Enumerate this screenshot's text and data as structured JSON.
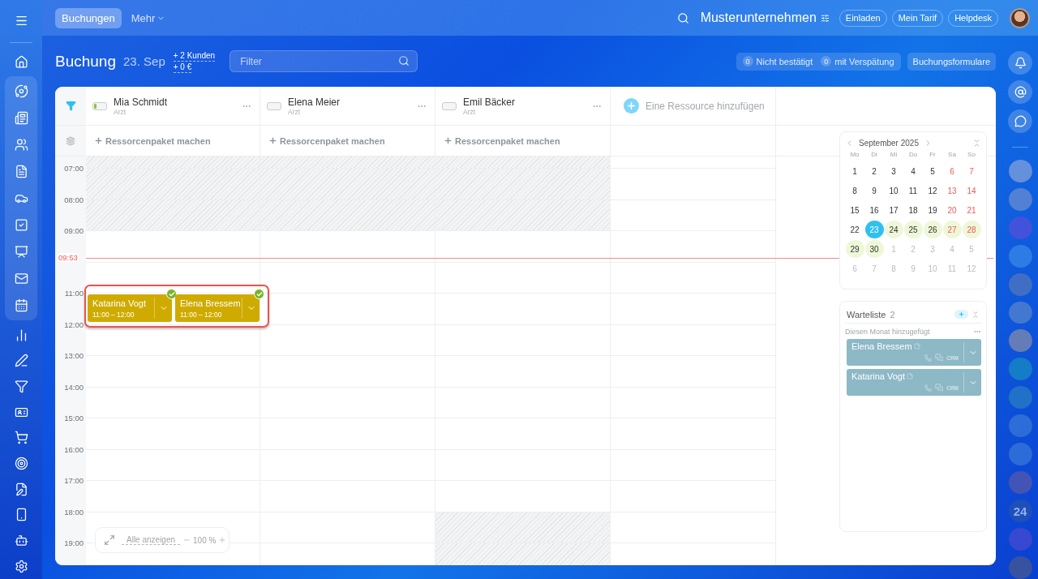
{
  "topbar": {
    "nav": [
      {
        "label": "Buchungen",
        "selected": true
      },
      {
        "label": "Mehr",
        "selected": false
      }
    ],
    "company": "Musterunternehmen",
    "buttons": [
      "Einladen",
      "Mein Tarif",
      "Helpdesk"
    ]
  },
  "header": {
    "title": "Buchung",
    "date": "23. Sep",
    "stats": [
      "+ 2 Kunden",
      "+ 0 €"
    ],
    "filter_placeholder": "Filter",
    "counters": [
      {
        "count": "0",
        "label": "Nicht bestätigt"
      },
      {
        "count": "0",
        "label": "mit Verspätung"
      }
    ],
    "forms_button": "Buchungsformulare"
  },
  "resources": [
    {
      "name": "Mia Schmidt",
      "role": "Arzt",
      "level": 0.2,
      "package": "Ressorcenpaket machen"
    },
    {
      "name": "Elena Meier",
      "role": "Arzt",
      "level": 0,
      "package": "Ressorcenpaket machen"
    },
    {
      "name": "Emil Bäcker",
      "role": "Arzt",
      "level": 0,
      "package": "Ressorcenpaket machen"
    }
  ],
  "add_resource": "Eine Ressource hinzufügen",
  "hours": [
    {
      "time": "07:00",
      "blocked": [
        true,
        true,
        true
      ]
    },
    {
      "time": "08:00",
      "blocked": [
        true,
        true,
        true
      ]
    },
    {
      "time": "09:00",
      "blocked": [
        false,
        false,
        false
      ]
    },
    {
      "blocked": [
        false,
        false,
        false
      ]
    },
    {
      "time": "11:00",
      "blocked": [
        false,
        false,
        false
      ]
    },
    {
      "time": "12:00",
      "blocked": [
        false,
        false,
        false
      ]
    },
    {
      "time": "13:00",
      "blocked": [
        false,
        false,
        false
      ]
    },
    {
      "time": "14:00",
      "blocked": [
        false,
        false,
        false
      ]
    },
    {
      "time": "15:00",
      "blocked": [
        false,
        false,
        false
      ]
    },
    {
      "time": "16:00",
      "blocked": [
        false,
        false,
        false
      ]
    },
    {
      "time": "17:00",
      "blocked": [
        false,
        false,
        false
      ]
    },
    {
      "time": "18:00",
      "blocked": [
        false,
        false,
        true
      ]
    },
    {
      "time": "19:00",
      "blocked": [
        false,
        false,
        true
      ]
    }
  ],
  "now": "09:53",
  "bookings": [
    {
      "name": "Katarina Vogt",
      "time": "11:00 – 12:00",
      "confirmed": true
    },
    {
      "name": "Elena Bressem",
      "time": "11:00 – 12:00",
      "confirmed": true
    }
  ],
  "zoom": {
    "show_all": "Alle anzeigen",
    "value": "100 %"
  },
  "mini_calendar": {
    "month": "September 2025",
    "weekdays": [
      "Mo",
      "Di",
      "Mi",
      "Do",
      "Fr",
      "Sa",
      "So"
    ],
    "weeks": [
      [
        {
          "day": "1",
          "kind": "weekday",
          "selected": false,
          "marked": false
        },
        {
          "day": "2",
          "kind": "weekday",
          "selected": false,
          "marked": false
        },
        {
          "day": "3",
          "kind": "weekday",
          "selected": false,
          "marked": false
        },
        {
          "day": "4",
          "kind": "weekday",
          "selected": false,
          "marked": false
        },
        {
          "day": "5",
          "kind": "weekday",
          "selected": false,
          "marked": false
        },
        {
          "day": "6",
          "kind": "weekend",
          "selected": false,
          "marked": false
        },
        {
          "day": "7",
          "kind": "weekend",
          "selected": false,
          "marked": false
        }
      ],
      [
        {
          "day": "8",
          "kind": "weekday",
          "selected": false,
          "marked": false
        },
        {
          "day": "9",
          "kind": "weekday",
          "selected": false,
          "marked": false
        },
        {
          "day": "10",
          "kind": "weekday",
          "selected": false,
          "marked": false
        },
        {
          "day": "11",
          "kind": "weekday",
          "selected": false,
          "marked": false
        },
        {
          "day": "12",
          "kind": "weekday",
          "selected": false,
          "marked": false
        },
        {
          "day": "13",
          "kind": "weekend",
          "selected": false,
          "marked": false
        },
        {
          "day": "14",
          "kind": "weekend",
          "selected": false,
          "marked": false
        }
      ],
      [
        {
          "day": "15",
          "kind": "weekday",
          "selected": false,
          "marked": false
        },
        {
          "day": "16",
          "kind": "weekday",
          "selected": false,
          "marked": false
        },
        {
          "day": "17",
          "kind": "weekday",
          "selected": false,
          "marked": false
        },
        {
          "day": "18",
          "kind": "weekday",
          "selected": false,
          "marked": false
        },
        {
          "day": "19",
          "kind": "weekday",
          "selected": false,
          "marked": false
        },
        {
          "day": "20",
          "kind": "weekend",
          "selected": false,
          "marked": false
        },
        {
          "day": "21",
          "kind": "weekend",
          "selected": false,
          "marked": false
        }
      ],
      [
        {
          "day": "22",
          "kind": "weekday",
          "selected": false,
          "marked": false
        },
        {
          "day": "23",
          "kind": "weekday",
          "selected": true,
          "marked": false
        },
        {
          "day": "24",
          "kind": "weekday",
          "selected": false,
          "marked": true
        },
        {
          "day": "25",
          "kind": "weekday",
          "selected": false,
          "marked": true
        },
        {
          "day": "26",
          "kind": "weekday",
          "selected": false,
          "marked": true
        },
        {
          "day": "27",
          "kind": "weekend",
          "selected": false,
          "marked": true
        },
        {
          "day": "28",
          "kind": "weekend",
          "selected": false,
          "marked": true
        }
      ],
      [
        {
          "day": "29",
          "kind": "weekday",
          "selected": false,
          "marked": true
        },
        {
          "day": "30",
          "kind": "weekday",
          "selected": false,
          "marked": true
        },
        {
          "day": "1",
          "kind": "other",
          "selected": false,
          "marked": false
        },
        {
          "day": "2",
          "kind": "other",
          "selected": false,
          "marked": false
        },
        {
          "day": "3",
          "kind": "other",
          "selected": false,
          "marked": false
        },
        {
          "day": "4",
          "kind": "other",
          "selected": false,
          "marked": false
        },
        {
          "day": "5",
          "kind": "other",
          "selected": false,
          "marked": false
        }
      ],
      [
        {
          "day": "6",
          "kind": "other",
          "selected": false,
          "marked": false
        },
        {
          "day": "7",
          "kind": "other",
          "selected": false,
          "marked": false
        },
        {
          "day": "8",
          "kind": "other",
          "selected": false,
          "marked": false
        },
        {
          "day": "9",
          "kind": "other",
          "selected": false,
          "marked": false
        },
        {
          "day": "10",
          "kind": "other",
          "selected": false,
          "marked": false
        },
        {
          "day": "11",
          "kind": "other",
          "selected": false,
          "marked": false
        },
        {
          "day": "12",
          "kind": "other",
          "selected": false,
          "marked": false
        }
      ]
    ]
  },
  "waitlist": {
    "title": "Warteliste",
    "count": "2",
    "section": "Diesen Monat hinzugefügt",
    "items": [
      {
        "name": "Elena Bressem",
        "crm": "CRM"
      },
      {
        "name": "Katarina Vogt",
        "crm": "CRM"
      }
    ]
  },
  "rail_badge": "24"
}
